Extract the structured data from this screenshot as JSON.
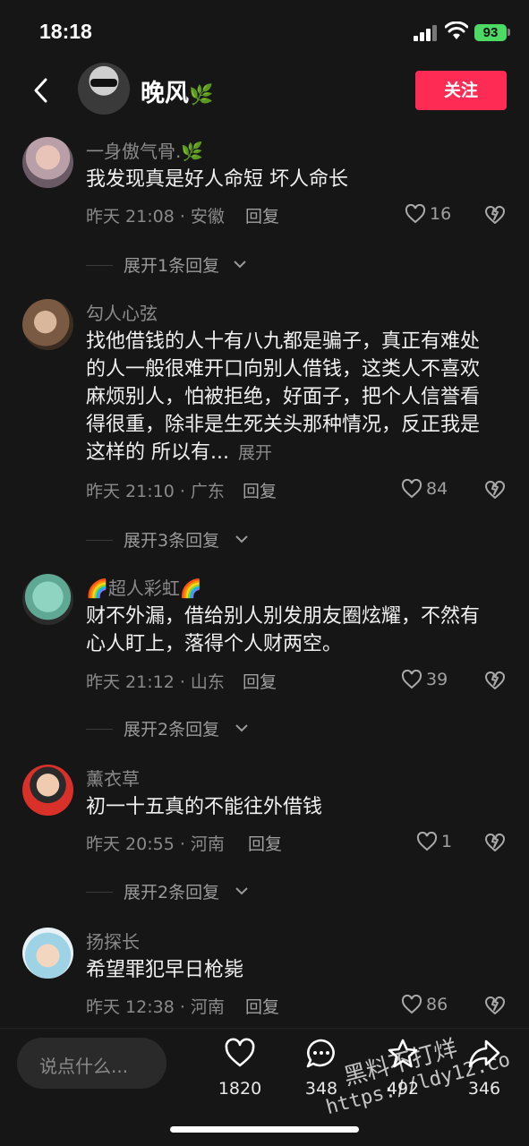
{
  "status_bar": {
    "time": "18:18",
    "battery": "93"
  },
  "header": {
    "name": "晚风",
    "name_emoji": "🌿",
    "follow_label": "关注"
  },
  "comments": [
    {
      "user": "一身傲气骨.",
      "user_emoji": "🌿",
      "text": "我发现真是好人命短  坏人命长",
      "more": "",
      "meta": "昨天 21:08 · 安徽",
      "reply": "回复",
      "likes": "16",
      "expand": "展开1条回复"
    },
    {
      "user": "勾人心弦",
      "user_emoji": "",
      "text": "找他借钱的人十有八九都是骗子，真正有难处的人一般很难开口向别人借钱，这类人不喜欢麻烦别人，怕被拒绝，好面子，把个人信誉看得很重，除非是生死关头那种情况，反正我是这样的 所以有...",
      "more": "展开",
      "meta": "昨天 21:10 · 广东",
      "reply": "回复",
      "likes": "84",
      "expand": "展开3条回复"
    },
    {
      "user": "超人彩虹",
      "user_emoji": "🌈",
      "text": "财不外漏，借给别人别发朋友圈炫耀，不然有心人盯上，落得个人财两空。",
      "more": "",
      "meta": "昨天 21:12 · 山东",
      "reply": "回复",
      "likes": "39",
      "expand": "展开2条回复"
    },
    {
      "user": "薰衣草",
      "user_emoji": "",
      "text": "初一十五真的不能往外借钱",
      "more": "",
      "meta": "昨天 20:55 · 河南",
      "reply": "回复",
      "likes": "1",
      "expand": "展开2条回复"
    },
    {
      "user": "扬探长",
      "user_emoji": "",
      "text": "希望罪犯早日枪毙",
      "more": "",
      "meta": "昨天 12:38 · 河南",
      "reply": "回复",
      "likes": "86",
      "expand": ""
    }
  ],
  "bottom_bar": {
    "input_placeholder": "说点什么...",
    "like_count": "1820",
    "comment_count": "348",
    "star_count": "492",
    "share_count": "346"
  },
  "watermark": {
    "line1": "黑料不打烊",
    "line2": "https://ldy12.co"
  },
  "colors": {
    "accent": "#fe2c55",
    "background": "#161616",
    "battery": "#4cd964"
  },
  "icons": [
    "back-icon",
    "heart-icon",
    "dislike-icon",
    "chevron-down-icon",
    "comment-icon",
    "star-icon",
    "share-icon",
    "wifi-icon",
    "signal-icon"
  ]
}
